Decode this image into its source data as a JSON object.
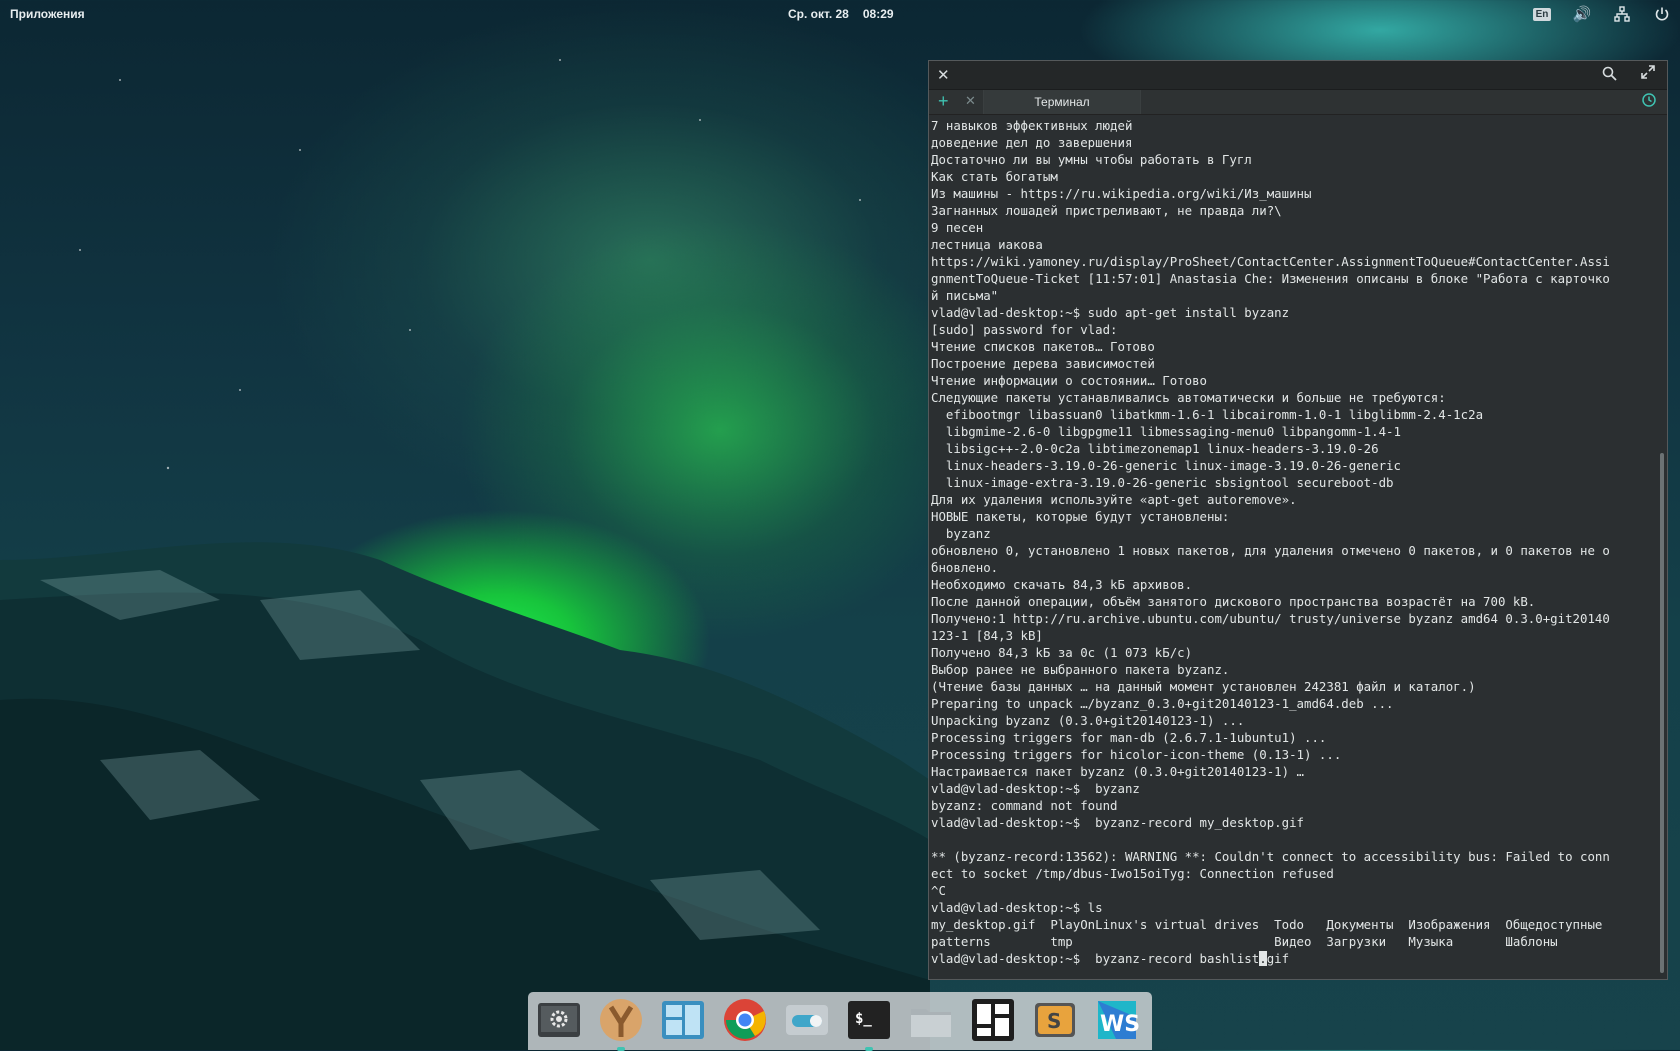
{
  "topbar": {
    "apps_label": "Приложения",
    "date": "Ср. окт. 28",
    "time": "08:29",
    "lang": "En"
  },
  "terminal": {
    "tab_title": "Терминал",
    "lines": [
      "7 навыков эффективных людей",
      "доведение дел до завершения",
      "Достаточно ли вы умны чтобы работать в Гугл",
      "Как стать богатым",
      "Из машины - https://ru.wikipedia.org/wiki/Из_машины",
      "Загнанных лошадей пристреливают, не правда ли?\\",
      "9 песен",
      "лестница иакова",
      "https://wiki.yamoney.ru/display/ProSheet/ContactCenter.AssignmentToQueue#ContactCenter.Assi",
      "gnmentToQueue-Ticket [11:57:01] Anastasia Che: Изменения описаны в блоке \"Работа с карточко",
      "й письма\"",
      "vlad@vlad-desktop:~$ sudo apt-get install byzanz",
      "[sudo] password for vlad:",
      "Чтение списков пакетов… Готово",
      "Построение дерева зависимостей",
      "Чтение информации о состоянии… Готово",
      "Следующие пакеты устанавливались автоматически и больше не требуются:",
      "  efibootmgr libassuan0 libatkmm-1.6-1 libcairomm-1.0-1 libglibmm-2.4-1c2a",
      "  libgmime-2.6-0 libgpgme11 libmessaging-menu0 libpangomm-1.4-1",
      "  libsigc++-2.0-0c2a libtimezonemap1 linux-headers-3.19.0-26",
      "  linux-headers-3.19.0-26-generic linux-image-3.19.0-26-generic",
      "  linux-image-extra-3.19.0-26-generic sbsigntool secureboot-db",
      "Для их удаления используйте «apt-get autoremove».",
      "НОВЫЕ пакеты, которые будут установлены:",
      "  byzanz",
      "обновлено 0, установлено 1 новых пакетов, для удаления отмечено 0 пакетов, и 0 пакетов не о",
      "бновлено.",
      "Необходимо скачать 84,3 kБ архивов.",
      "После данной операции, объём занятого дискового пространства возрастёт на 700 kB.",
      "Получено:1 http://ru.archive.ubuntu.com/ubuntu/ trusty/universe byzanz amd64 0.3.0+git20140",
      "123-1 [84,3 kB]",
      "Получено 84,3 kБ за 0с (1 073 kБ/c)",
      "Выбор ранее не выбранного пакета byzanz.",
      "(Чтение базы данных … на данный момент установлен 242381 файл и каталог.)",
      "Preparing to unpack …/byzanz_0.3.0+git20140123-1_amd64.deb ...",
      "Unpacking byzanz (0.3.0+git20140123-1) ...",
      "Processing triggers for man-db (2.6.7.1-1ubuntu1) ...",
      "Processing triggers for hicolor-icon-theme (0.13-1) ...",
      "Настраивается пакет byzanz (0.3.0+git20140123-1) …",
      "vlad@vlad-desktop:~$  byzanz",
      "byzanz: command not found",
      "vlad@vlad-desktop:~$  byzanz-record my_desktop.gif",
      "",
      "** (byzanz-record:13562): WARNING **: Couldn't connect to accessibility bus: Failed to conn",
      "ect to socket /tmp/dbus-Iwo15oiTyg: Connection refused",
      "^C",
      "vlad@vlad-desktop:~$ ls",
      "my_desktop.gif  PlayOnLinux's virtual drives  Todo   Документы  Изображения  Общедоступные",
      "patterns        tmp                           Видео  Загрузки   Музыка       Шаблоны"
    ],
    "prompt_line_before_cursor": "vlad@vlad-desktop:~$  byzanz-record bashlist",
    "cursor_char": ".",
    "prompt_line_after_cursor": "gif"
  },
  "dock": {
    "items": [
      {
        "name": "settings-app",
        "label": "Settings"
      },
      {
        "name": "yandex-browser-app",
        "label": "Y"
      },
      {
        "name": "workspaces-app",
        "label": "Workspaces"
      },
      {
        "name": "chrome-app",
        "label": "Chrome"
      },
      {
        "name": "switchboard-app",
        "label": "Switch"
      },
      {
        "name": "terminal-app",
        "label": "$_"
      },
      {
        "name": "files-app",
        "label": "Files"
      },
      {
        "name": "multitasking-app",
        "label": "Tiles"
      },
      {
        "name": "sublime-app",
        "label": "S"
      },
      {
        "name": "webstorm-app",
        "label": "WS"
      }
    ]
  }
}
